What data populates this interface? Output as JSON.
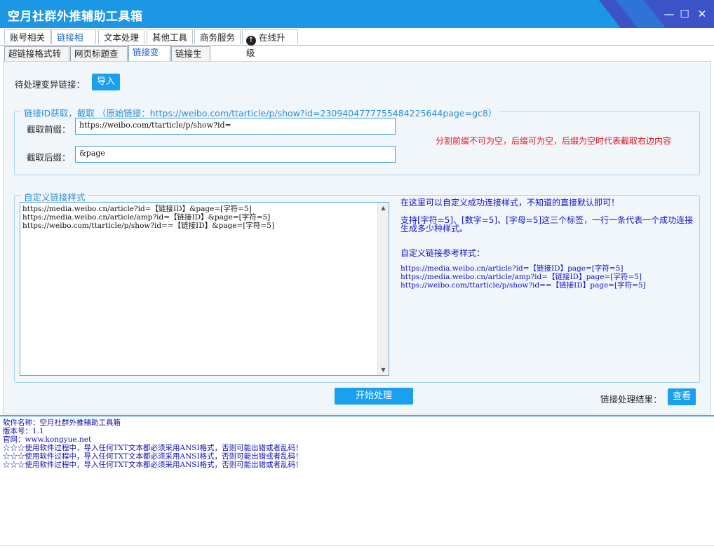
{
  "window": {
    "title": "空月社群外推辅助工具箱",
    "controls": {
      "minimize": "—",
      "maximize": "☐",
      "close": "✕"
    }
  },
  "main_tabs": [
    {
      "label": "账号相关"
    },
    {
      "label": "链接相关",
      "active": true
    },
    {
      "label": "文本处理"
    },
    {
      "label": "其他工具"
    },
    {
      "label": "商务服务"
    },
    {
      "label": "在线升级",
      "icon": "upload-arrow-icon"
    }
  ],
  "sub_tabs": [
    {
      "label": "超链接格式转换"
    },
    {
      "label": "网页标题查询"
    },
    {
      "label": "链接变异",
      "active": true
    },
    {
      "label": "链接生成"
    }
  ],
  "variant": {
    "pending_label": "待处理变异链接：",
    "import_button": "导入",
    "id_group": {
      "title": "链接ID获取，截取  （原始链接：https://weibo.com/ttarticle/p/show?id=2309404777755484225644page=gc8）",
      "prefix_label": "截取前缀：",
      "prefix_value": "https://weibo.com/ttarticle/p/show?id=",
      "suffix_label": "截取后缀：",
      "suffix_value": "&page",
      "hint": "分割前缀不可为空，后缀可为空，后缀为空时代表截取右边内容"
    },
    "style_group": {
      "title": "自定义链接样式",
      "lines": [
        "https://media.weibo.cn/article?id=【链接ID】&page=[字符=5]",
        "https://media.weibo.cn/article/amp?id=【链接ID】&page=[字符=5]",
        "https://weibo.com/ttarticle/p/show?id==【链接ID】&page=[字符=5]"
      ],
      "help_title": "在这里可以自定义成功连接样式，不知道的直接默认即可！",
      "help_desc_1": "支持[字符=5]、[数字=5]、[字母=5]这三个标签，一行一条代表一个成功连接",
      "help_desc_2": "生成多少种样式。",
      "ref_title": "自定义链接参考样式：",
      "ref_lines": [
        "https://media.weibo.cn/article?id=【链接ID】page=[字符=5]",
        "https://media.weibo.cn/article/amp?id=【链接ID】page=[字符=5]",
        "https://weibo.com/ttarticle/p/show?id==【链接ID】page=[字符=5]"
      ]
    },
    "start_button": "开始处理",
    "result_label": "链接处理结果：",
    "view_button": "查看"
  },
  "log": {
    "lines": [
      "软件名称：空月社群外推辅助工具箱",
      "版本号：1.1",
      "官网：www.kongyue.net",
      "",
      "☆☆☆使用软件过程中，导入任何TXT文本都必须采用ANSI格式，否则可能出错或者乱码！",
      "☆☆☆使用软件过程中，导入任何TXT文本都必须采用ANSI格式，否则可能出错或者乱码！",
      "☆☆☆使用软件过程中，导入任何TXT文本都必须采用ANSI格式，否则可能出错或者乱码！"
    ]
  }
}
